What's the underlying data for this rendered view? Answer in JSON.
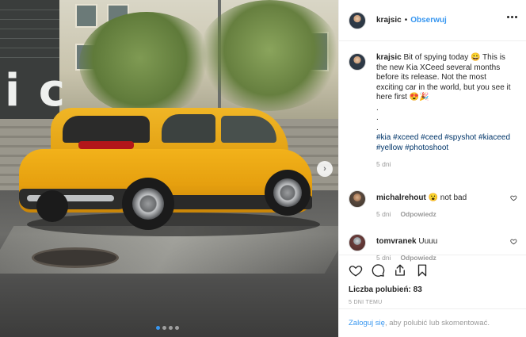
{
  "photo": {
    "background_letters": "i c",
    "carousel_dots": 4,
    "active_dot": 1
  },
  "post": {
    "author": "krajsic",
    "separator": "•",
    "follow_label": "Obserwuj",
    "caption": {
      "username": "krajsic",
      "text": "Bit of spying today 😀 This is the new Kia XCeed several months before its release. Not the most exciting car in the world, but you see it here first 😍🎉",
      "dots": [
        ".",
        ".",
        "."
      ],
      "hashtags": [
        "#kia",
        "#xceed",
        "#ceed",
        "#spyshot",
        "#kiaceed",
        "#yellow",
        "#photoshoot"
      ],
      "time": "5 dni"
    },
    "comments": [
      {
        "username": "michalrehout",
        "text": "😮 not bad",
        "time": "5 dni",
        "reply_label": "Odpowiedz"
      },
      {
        "username": "tomvranek",
        "text": "Uuuu",
        "time": "5 dni",
        "reply_label": "Odpowiedz"
      }
    ],
    "likes_label": "Liczba polubień:",
    "likes_count": "83",
    "date": "5 DNI TEMU",
    "login": {
      "link": "Zaloguj się",
      "rest": ", aby polubić lub skomentować."
    }
  },
  "colors": {
    "link_blue": "#3897f0",
    "hashtag": "#003569",
    "muted": "#999999",
    "text": "#262626"
  }
}
